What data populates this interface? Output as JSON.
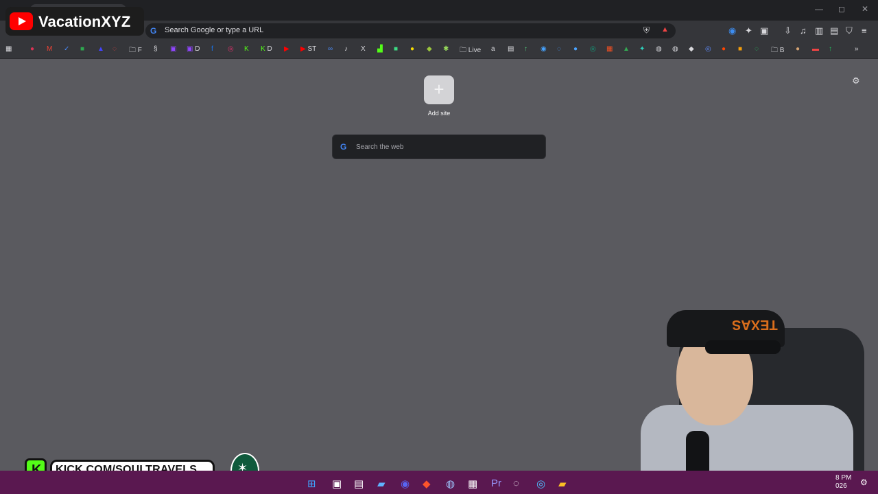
{
  "tab": {
    "close_icon": "✕",
    "new_icon": "+"
  },
  "window_controls": {
    "minimize": "—",
    "maximize": "◻",
    "close": "✕"
  },
  "address_bar": {
    "placeholder": "Search Google or type a URL"
  },
  "toolbar_icons": {
    "shield": "shield-icon",
    "rewards": "triangle-icon",
    "extensions": [
      "circle-icon",
      "puzzle-icon",
      "camera-icon",
      "download-icon",
      "music-icon",
      "sidebar-icon",
      "wallet-icon",
      "shield-outline-icon",
      "menu-icon"
    ]
  },
  "bookmarks": {
    "items": [
      {
        "label": "F",
        "icon": "folder-icon",
        "color": "#d9d9dd"
      },
      {
        "label": "D",
        "icon": "twitch-icon",
        "color": "#9146ff"
      },
      {
        "label": "D",
        "icon": "kick-icon",
        "color": "#53fc18"
      },
      {
        "label": "ST",
        "icon": "youtube-icon",
        "color": "#ff0000"
      },
      {
        "label": "Live",
        "icon": "folder-icon",
        "color": "#d9d9dd"
      },
      {
        "label": "B",
        "icon": "folder-icon",
        "color": "#d9d9dd"
      }
    ]
  },
  "ntp": {
    "add_site_label": "Add site",
    "add_site_icon": "+",
    "search_placeholder": "Search the web",
    "settings_icon": "gear-icon"
  },
  "overlays": {
    "channel_name": "VacationXYZ",
    "kick_url": "KICK.COM/SOULTRAVELS",
    "kick_letter": "K"
  },
  "taskbar": {
    "time": "8 PM",
    "year": "026",
    "icons": [
      "windows-icon",
      "files-icon",
      "store-icon",
      "photos-icon",
      "discord-icon",
      "brave-icon",
      "steam-icon",
      "calculator-icon",
      "premiere-icon",
      "obs-icon",
      "edge-icon",
      "folder-icon"
    ]
  },
  "webcam": {
    "cap_text": "TEXAS"
  }
}
